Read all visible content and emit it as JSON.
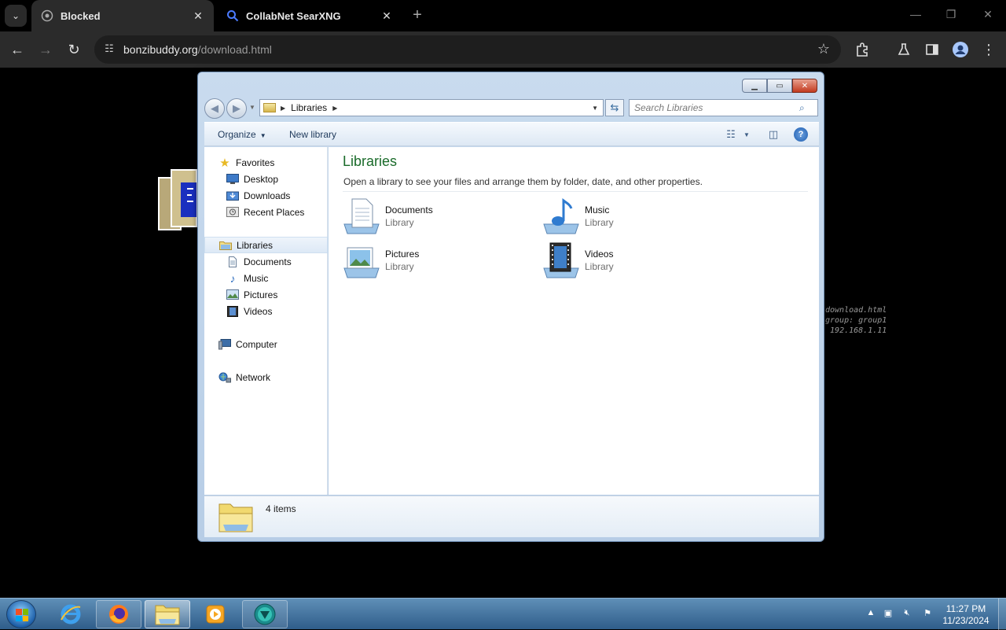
{
  "browser": {
    "tabs": [
      {
        "title": "Blocked",
        "active": true
      },
      {
        "title": "CollabNet SearXNG",
        "active": false
      }
    ],
    "url": {
      "host": "bonzibuddy.org",
      "path": "/download.html"
    }
  },
  "page": {
    "terminal_lines": [
      "download.html",
      "group: group1",
      "192.168.1.11"
    ]
  },
  "explorer": {
    "breadcrumb": [
      "Libraries"
    ],
    "search_placeholder": "Search Libraries",
    "commands": {
      "organize": "Organize",
      "new_library": "New library"
    },
    "nav": {
      "favorites": {
        "label": "Favorites",
        "items": [
          "Desktop",
          "Downloads",
          "Recent Places"
        ]
      },
      "libraries": {
        "label": "Libraries",
        "items": [
          "Documents",
          "Music",
          "Pictures",
          "Videos"
        ]
      },
      "computer": "Computer",
      "network": "Network"
    },
    "content": {
      "title": "Libraries",
      "description": "Open a library to see your files and arrange them by folder, date, and other properties.",
      "items": [
        {
          "name": "Documents",
          "type": "Library",
          "icon": "documents-library-icon"
        },
        {
          "name": "Music",
          "type": "Library",
          "icon": "music-library-icon"
        },
        {
          "name": "Pictures",
          "type": "Library",
          "icon": "pictures-library-icon"
        },
        {
          "name": "Videos",
          "type": "Library",
          "icon": "videos-library-icon"
        }
      ]
    },
    "details": {
      "count": "4 items"
    }
  },
  "taskbar": {
    "apps": [
      "internet-explorer",
      "firefox",
      "windows-explorer",
      "media-player",
      "browser"
    ],
    "clock": {
      "time": "11:27 PM",
      "date": "11/23/2024"
    }
  }
}
